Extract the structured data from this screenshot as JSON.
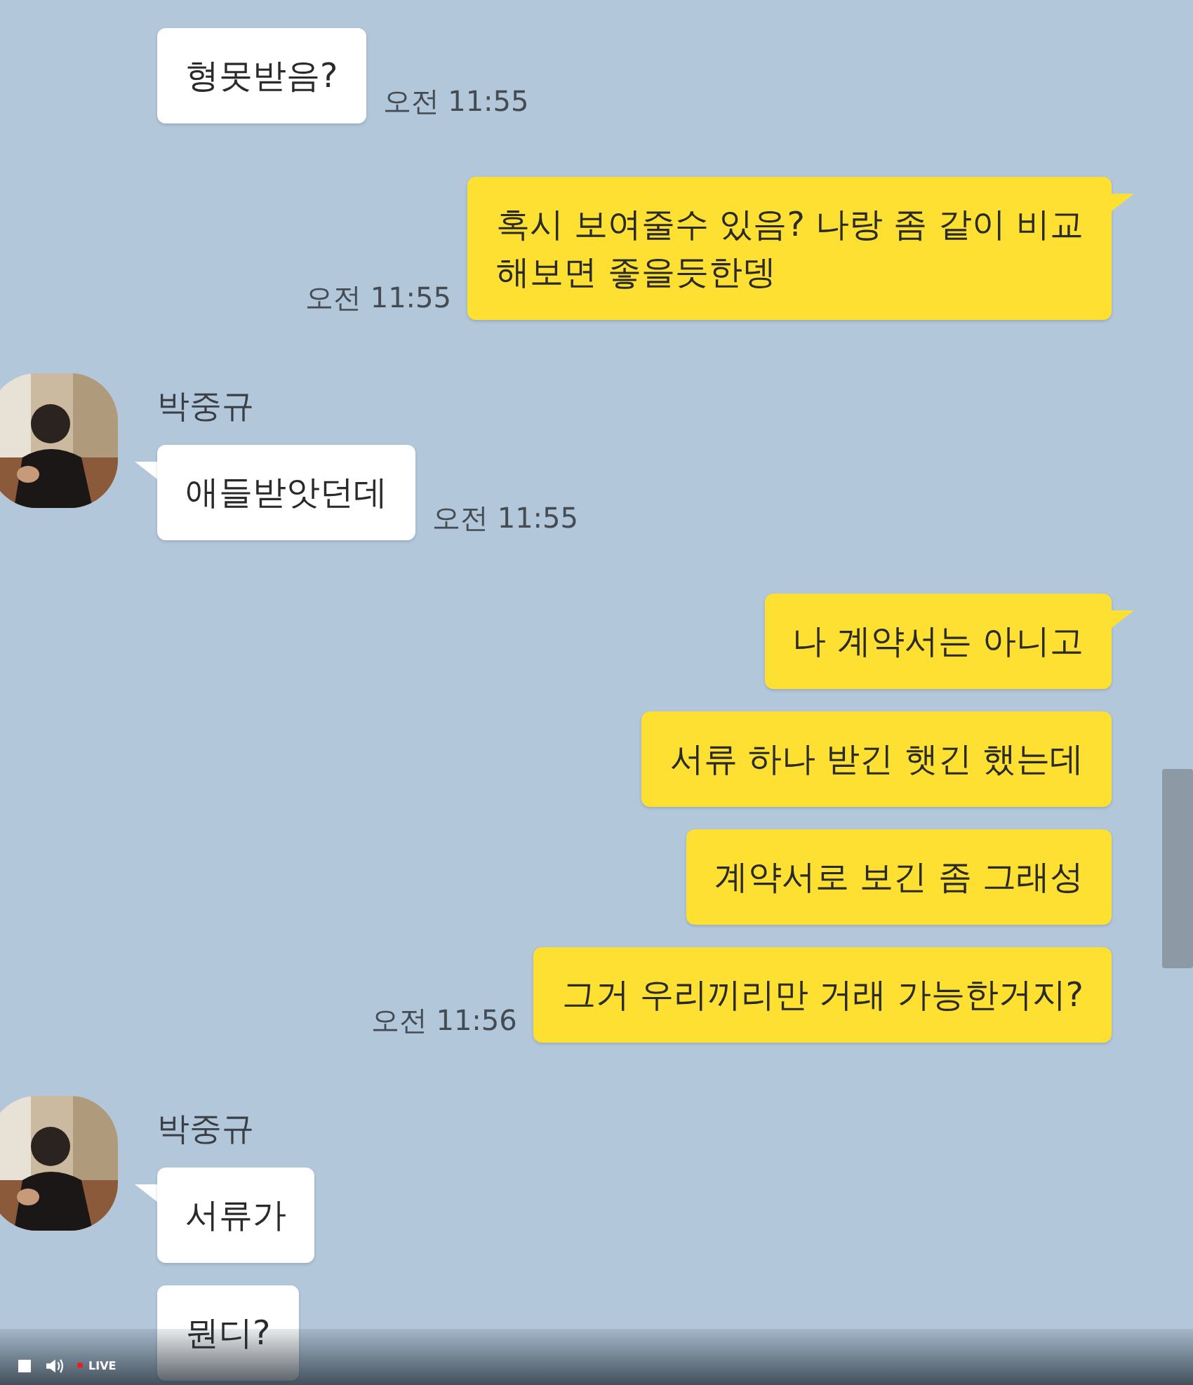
{
  "messages": [
    {
      "kind": "received",
      "text": "형못받음?",
      "time": "오전 11:55",
      "tail": false
    },
    {
      "kind": "sent",
      "text": "혹시 보여줄수 있음? 나랑 좀 같이 비교\n해보면 좋을듯한뎅",
      "time": "오전 11:55",
      "tail": true
    },
    {
      "kind": "received",
      "sender": "박중규",
      "text": "애들받앗던데",
      "time": "오전 11:55",
      "tail": true
    },
    {
      "kind": "sent",
      "text": "나 계약서는 아니고",
      "tail": true
    },
    {
      "kind": "sent",
      "text": "서류 하나 받긴 햇긴 했는데",
      "tail": false
    },
    {
      "kind": "sent",
      "text": "계약서로 보긴 좀 그래성",
      "tail": false
    },
    {
      "kind": "sent",
      "text": "그거 우리끼리만 거래 가능한거지?",
      "time": "오전 11:56",
      "tail": false
    },
    {
      "kind": "received",
      "sender": "박중규",
      "text": "서류가",
      "tail": true
    },
    {
      "kind": "received",
      "text": "뭔디?",
      "tail": false
    }
  ],
  "player": {
    "label": "LIVE"
  }
}
